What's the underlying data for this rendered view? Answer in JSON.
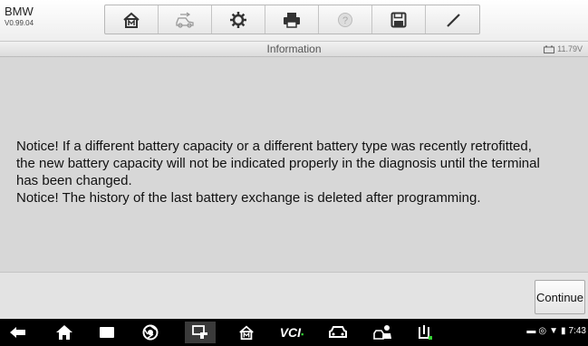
{
  "header": {
    "brand": "BMW",
    "version": "V0.99.04"
  },
  "toolbar": {
    "buttons": [
      {
        "name": "home",
        "icon": "home-icon"
      },
      {
        "name": "vehicle-swap",
        "icon": "car-swap-icon"
      },
      {
        "name": "settings",
        "icon": "gear-icon"
      },
      {
        "name": "print",
        "icon": "printer-icon"
      },
      {
        "name": "help",
        "icon": "help-icon"
      },
      {
        "name": "save",
        "icon": "save-icon"
      },
      {
        "name": "data-logging",
        "icon": "pen-icon"
      }
    ]
  },
  "titlebar": {
    "title": "Information",
    "voltage": "11.79V"
  },
  "content": {
    "notice": "Notice! If a different battery capacity or a different battery type was recently retrofitted,\nthe new battery capacity will not be indicated properly in the diagnosis until the terminal\nhas been changed.\n Notice! The history of the last battery exchange is deleted after programming."
  },
  "footer": {
    "continue_label": "Continue"
  },
  "navbar": {
    "vcl_label": "VCI",
    "time": "7:43",
    "colors": {
      "vcl_status": "#34d234",
      "background": "#000000"
    }
  }
}
